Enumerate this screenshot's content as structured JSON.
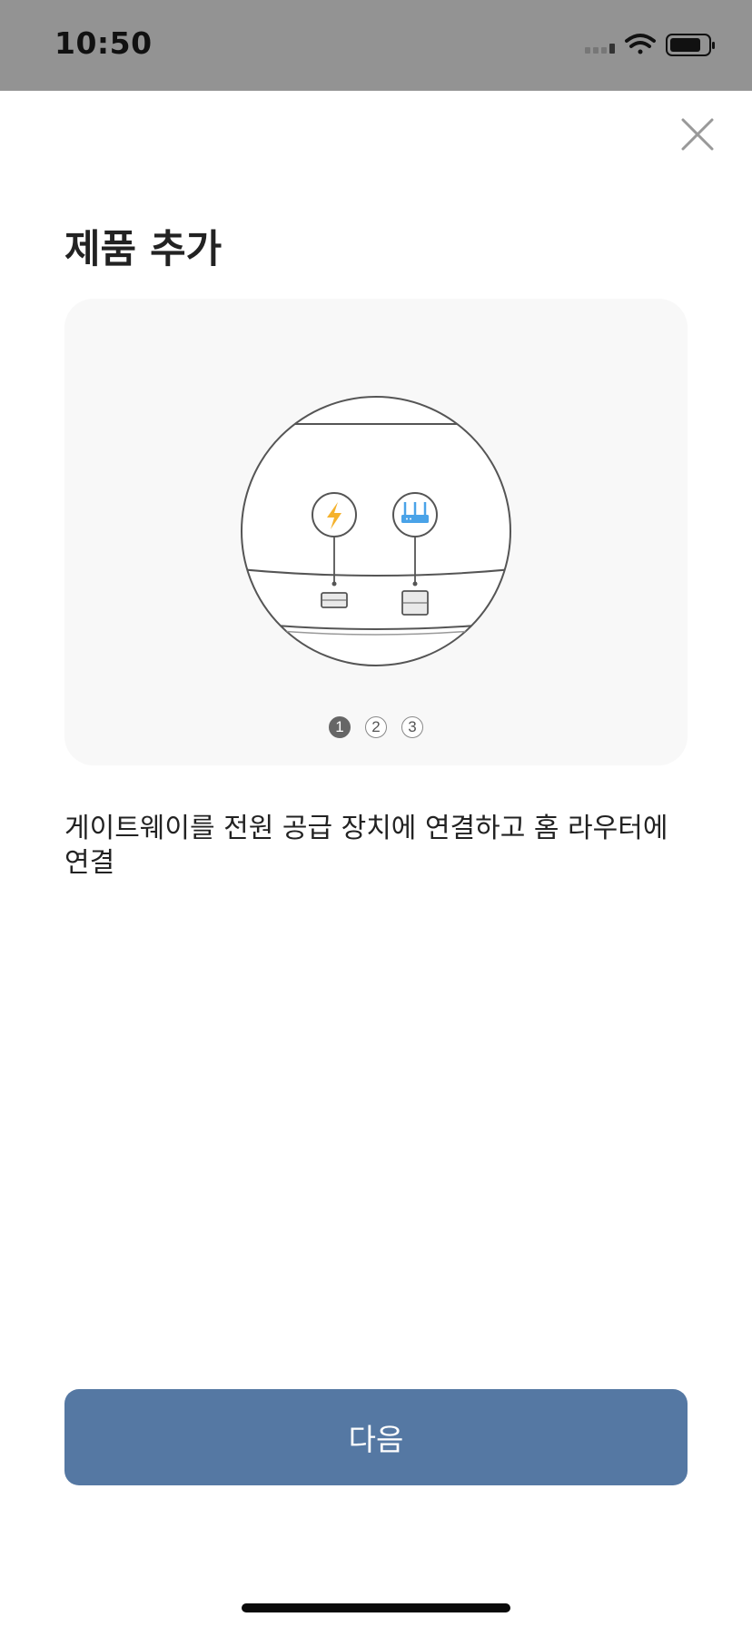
{
  "status_bar": {
    "time": "10:50",
    "icons": [
      "cellular-signal-icon",
      "wifi-icon",
      "battery-icon"
    ]
  },
  "header": {
    "close_icon": "close-icon",
    "title": "제품 추가"
  },
  "illustration": {
    "icons": [
      "power-bolt-icon",
      "router-icon"
    ],
    "colors": {
      "bolt": "#f5b22d",
      "router": "#4aa3e8",
      "outline": "#555555"
    }
  },
  "pager": {
    "pages": [
      "1",
      "2",
      "3"
    ],
    "current": 1
  },
  "description": "게이트웨이를 전원 공급 장치에 연결하고 홈 라우터에 연결",
  "next_button": {
    "label": "다음",
    "color": "#5578a3"
  }
}
